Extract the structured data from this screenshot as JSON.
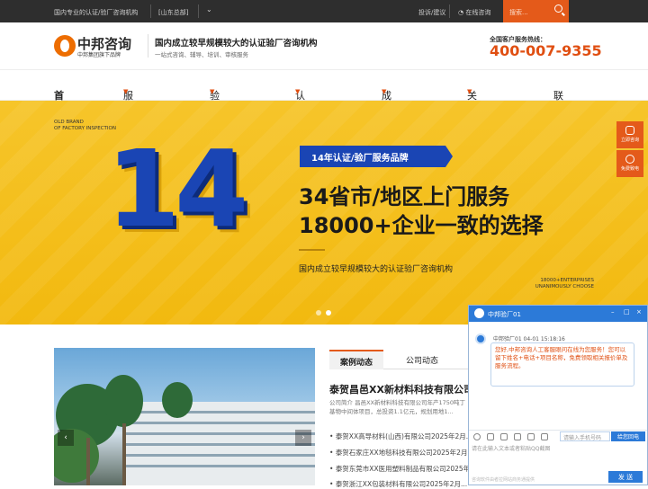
{
  "topbar": {
    "slogan": "国内专业的认证/验厂咨询机构",
    "location": "[山东总部]",
    "feedback": "投诉/建议",
    "online": "在线咨询",
    "search_placeholder": "搜索..."
  },
  "header": {
    "brand": "中邦咨询",
    "brand_sub": "中邦集团旗下品牌",
    "tagline": "国内成立较早规模较大的认证验厂咨询机构",
    "tagline_sub": "一站式咨询、辅导、培训、审核服务",
    "hotline_label": "全国客户服务热线：",
    "hotline": "400-007-9355"
  },
  "nav": {
    "items": [
      {
        "label": "首页",
        "has_caret": false
      },
      {
        "label": "服务项目",
        "has_caret": true
      },
      {
        "label": "验厂服务",
        "has_caret": true
      },
      {
        "label": "认证服务",
        "has_caret": true
      },
      {
        "label": "成功案例",
        "has_caret": true
      },
      {
        "label": "关于中邦",
        "has_caret": true
      },
      {
        "label": "联系我们",
        "has_caret": false
      }
    ]
  },
  "banner": {
    "old_brand_line1": "OLD BRAND",
    "old_brand_line2": "OF FACTORY INSPECTION",
    "big_number": "14",
    "badge": "14年认证/验厂服务品牌",
    "headline1": "34省市/地区上门服务",
    "headline2": "18000+企业一致的选择",
    "desc": "国内成立较早规模较大的认证验厂咨询机构",
    "en_line1": "18000+ENTERPRISES",
    "en_line2": "UNANIMOUSLY CHOOSE",
    "slides": 2,
    "active_slide": 2
  },
  "side": {
    "consult": "立即咨询",
    "call": "免费致电"
  },
  "cases": {
    "tabs": [
      "案例动态",
      "公司动态"
    ],
    "active_tab": 0,
    "featured_title": "泰贺昌邑XX新材料科技有限公司",
    "featured_summary": "公司简介 昌邑XX新材料科技有限公司年产1750吨丁基物中间体项目，总投资1.1亿元，规划用地1...",
    "list": [
      "泰贺XX高导材料(山西)有限公司2025年2月...",
      "泰贺石家庄XX地毯科技有限公司2025年2月...",
      "泰贺东莞市XX医用塑料制品有限公司2025年2月...",
      "泰贺浙江XX包装材料有限公司2025年2月..."
    ]
  },
  "chat": {
    "title": "中邦验厂01",
    "agent_line": "中邦验厂01  04-01 15:18:16",
    "message": "您好,中邦咨询人工客服眼问在线为您服务！您可以留下姓名+电话+项目名称，免费领取相关报价单及服务流程。",
    "phone_placeholder": "请输入手机号码",
    "call_back": "给您回电",
    "input_placeholder": "请在此输入文本或者粘贴QQ截图",
    "footnote": "咨询软件由者拉网站商务通提供",
    "send": "发 送"
  },
  "colors": {
    "accent": "#e45a1a",
    "banner": "#f2b90f",
    "navy": "#1a45b4",
    "chat_blue": "#2c7ad8"
  }
}
